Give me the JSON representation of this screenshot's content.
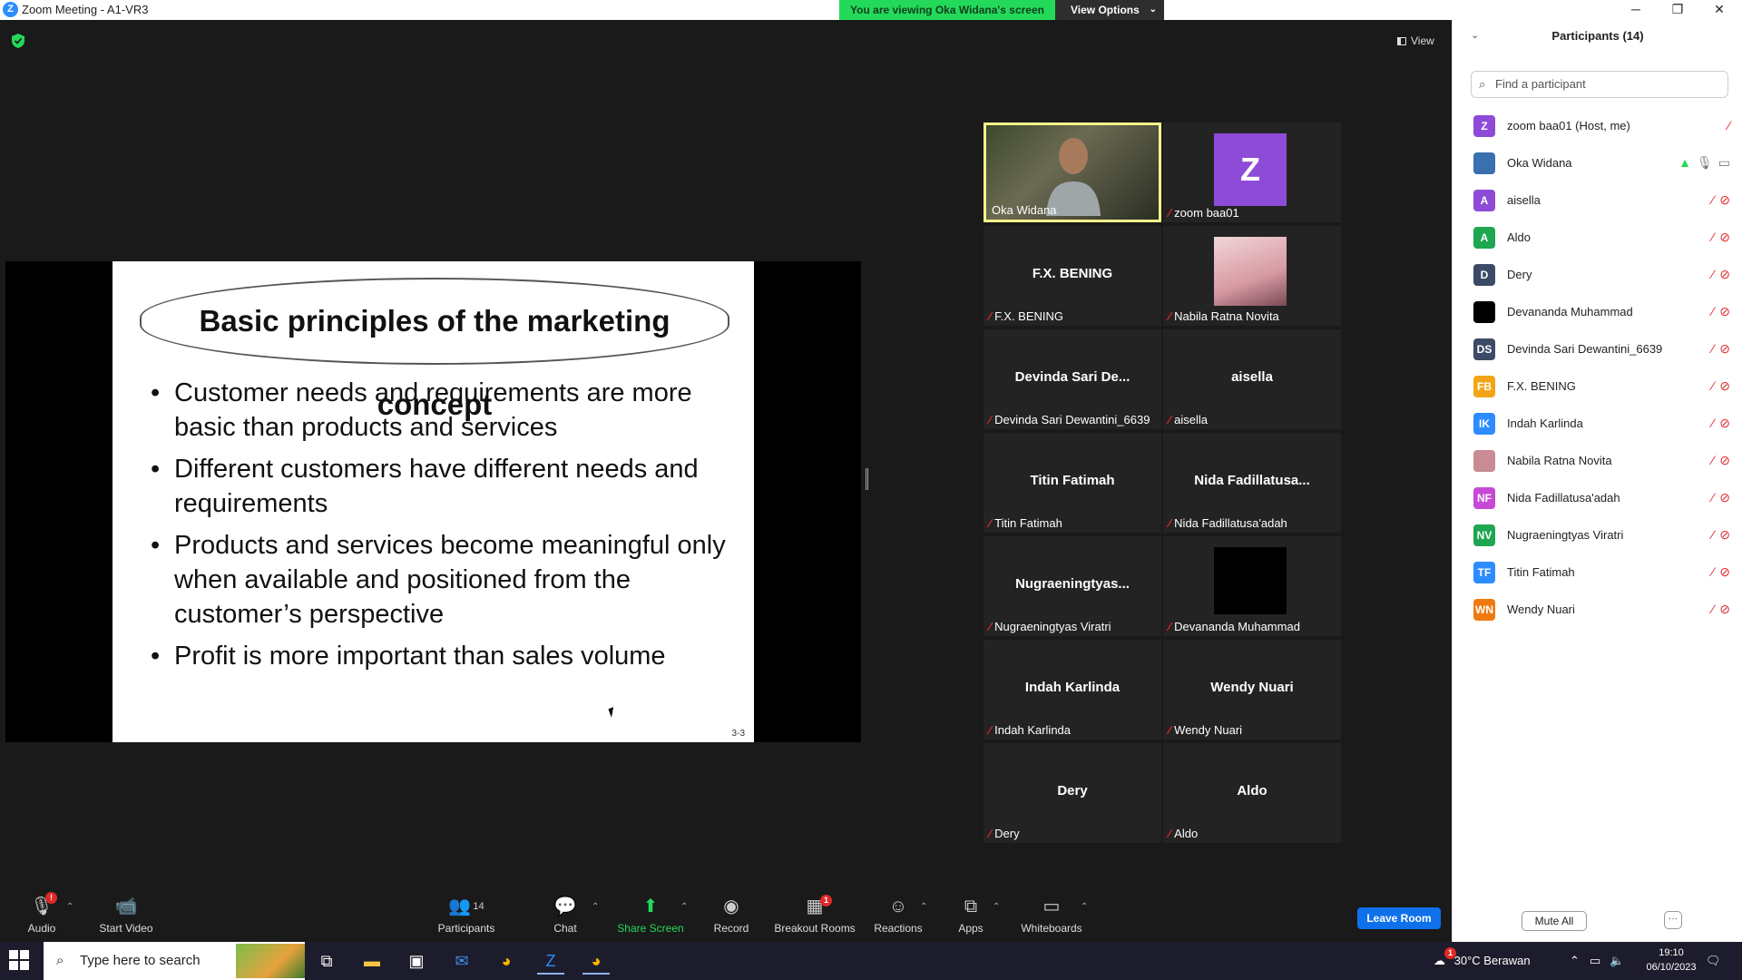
{
  "window": {
    "title": "Zoom Meeting - A1-VR3",
    "logo": "Z",
    "minimize": "─",
    "restore": "❐",
    "close": "✕"
  },
  "banner": {
    "viewing": "You are viewing Oka Widana's screen",
    "view_options": "View Options"
  },
  "view_button": "View",
  "slide": {
    "title": "Basic principles of the marketing concept",
    "bullets": [
      "Customer needs and requirements are more basic than products and services",
      "Different customers have different needs and requirements",
      "Products and services become meaningful only when available and positioned from the customer’s perspective",
      "Profit is more important than sales volume"
    ],
    "page": "3-3"
  },
  "gallery": [
    {
      "name": "",
      "label": "Oka Widana",
      "muted": false,
      "kind": "video"
    },
    {
      "name": "Z",
      "label": "zoom baa01",
      "muted": true,
      "kind": "avatar"
    },
    {
      "name": "F.X. BENING",
      "label": "F.X. BENING",
      "muted": true,
      "kind": "text"
    },
    {
      "name": "",
      "label": "Nabila Ratna Novita",
      "muted": true,
      "kind": "photo"
    },
    {
      "name": "Devinda Sari De...",
      "label": "Devinda Sari Dewantini_6639",
      "muted": true,
      "kind": "text"
    },
    {
      "name": "aisella",
      "label": "aisella",
      "muted": true,
      "kind": "text"
    },
    {
      "name": "Titin Fatimah",
      "label": "Titin Fatimah",
      "muted": true,
      "kind": "text"
    },
    {
      "name": "Nida Fadillatusa...",
      "label": "Nida Fadillatusa'adah",
      "muted": true,
      "kind": "text"
    },
    {
      "name": "Nugraeningtyas...",
      "label": "Nugraeningtyas Viratri",
      "muted": true,
      "kind": "text"
    },
    {
      "name": "",
      "label": "Devananda Muhammad",
      "muted": true,
      "kind": "black"
    },
    {
      "name": "Indah Karlinda",
      "label": "Indah Karlinda",
      "muted": true,
      "kind": "text"
    },
    {
      "name": "Wendy Nuari",
      "label": "Wendy Nuari",
      "muted": true,
      "kind": "text"
    },
    {
      "name": "Dery",
      "label": "Dery",
      "muted": true,
      "kind": "text"
    },
    {
      "name": "Aldo",
      "label": "Aldo",
      "muted": true,
      "kind": "text"
    }
  ],
  "toolbar": {
    "audio": "Audio",
    "audio_badge": "!",
    "start_video": "Start Video",
    "participants": "Participants",
    "participants_count": "14",
    "chat": "Chat",
    "share_screen": "Share Screen",
    "record": "Record",
    "breakout_rooms": "Breakout Rooms",
    "breakout_badge": "1",
    "reactions": "Reactions",
    "apps": "Apps",
    "whiteboards": "Whiteboards",
    "leave_room": "Leave Room"
  },
  "panel": {
    "title": "Participants (14)",
    "search_placeholder": "Find a participant",
    "mute_all": "Mute All",
    "more": "···",
    "participants": [
      {
        "initials": "Z",
        "name": "zoom baa01 (Host, me)",
        "color": "#8e4bd8",
        "icons": "mic-muted"
      },
      {
        "initials": "",
        "name": "Oka Widana",
        "color": "#3a6fb0",
        "icons": "share-mic-video"
      },
      {
        "initials": "A",
        "name": "aisella",
        "color": "#8e4bd8",
        "icons": "mic-muted video-off"
      },
      {
        "initials": "A",
        "name": "Aldo",
        "color": "#1ea650",
        "icons": "mic-muted video-off"
      },
      {
        "initials": "D",
        "name": "Dery",
        "color": "#3b4a66",
        "icons": "mic-muted video-off"
      },
      {
        "initials": "",
        "name": "Devananda Muhammad",
        "color": "#000000",
        "icons": "mic-muted video-off"
      },
      {
        "initials": "DS",
        "name": "Devinda Sari Dewantini_6639",
        "color": "#3b4a66",
        "icons": "mic-muted video-off"
      },
      {
        "initials": "FB",
        "name": "F.X. BENING",
        "color": "#f2a516",
        "icons": "mic-muted video-off"
      },
      {
        "initials": "IK",
        "name": "Indah Karlinda",
        "color": "#2d8cff",
        "icons": "mic-muted video-off"
      },
      {
        "initials": "",
        "name": "Nabila Ratna Novita",
        "color": "#c98b94",
        "icons": "mic-muted video-off"
      },
      {
        "initials": "NF",
        "name": "Nida Fadillatusa'adah",
        "color": "#c649d6",
        "icons": "mic-muted video-off"
      },
      {
        "initials": "NV",
        "name": "Nugraeningtyas Viratri",
        "color": "#1ea650",
        "icons": "mic-muted video-off"
      },
      {
        "initials": "TF",
        "name": "Titin Fatimah",
        "color": "#2d8cff",
        "icons": "mic-muted video-off"
      },
      {
        "initials": "WN",
        "name": "Wendy Nuari",
        "color": "#f07a12",
        "icons": "mic-muted video-off"
      }
    ]
  },
  "taskbar": {
    "search_placeholder": "Type here to search",
    "weather": "30°C  Berawan",
    "weather_badge": "1",
    "time": "19:10",
    "date": "06/10/2023"
  },
  "colors": {
    "accent": "#2d8cff",
    "banner_green": "#23d959",
    "muted_red": "#e02828",
    "active_border": "#f5f58a"
  }
}
